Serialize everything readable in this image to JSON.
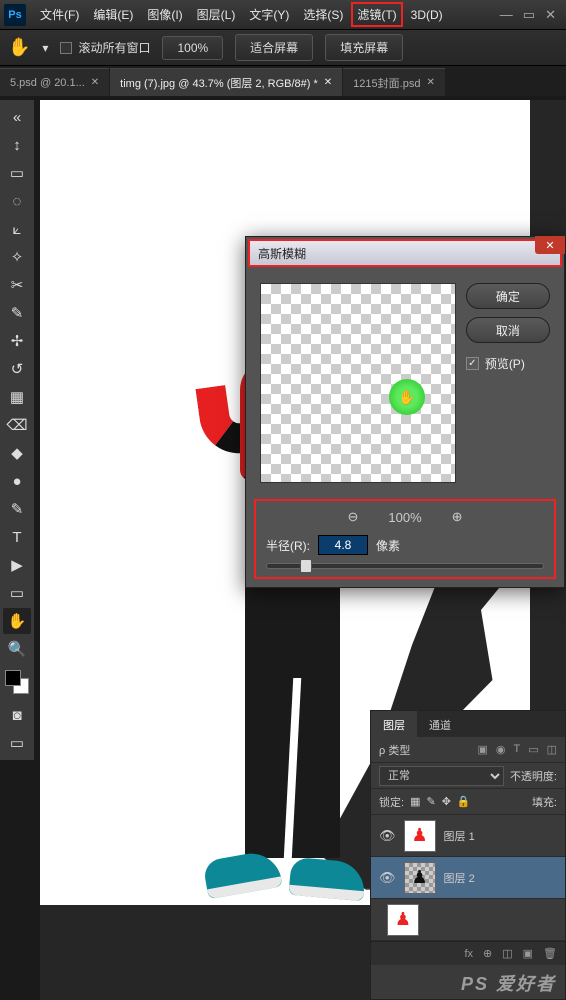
{
  "menu": {
    "items": [
      "文件(F)",
      "编辑(E)",
      "图像(I)",
      "图层(L)",
      "文字(Y)",
      "选择(S)",
      "滤镜(T)",
      "3D(D)"
    ],
    "highlight_index": 6
  },
  "window_controls": {
    "min": "—",
    "max": "▭",
    "close": "✕"
  },
  "options": {
    "scroll_all": "滚动所有窗口",
    "zoom": "100%",
    "fit": "适合屏幕",
    "fill": "填充屏幕"
  },
  "tabs": [
    {
      "label": "5.psd @ 20.1...",
      "active": false
    },
    {
      "label": "timg (7).jpg @ 43.7% (图层 2, RGB/8#) *",
      "active": true
    },
    {
      "label": "1215封面.psd",
      "active": false
    }
  ],
  "tools": [
    "↕",
    "▭",
    "◌",
    "⟀",
    "✧",
    "✂",
    "✎",
    "✢",
    "↺",
    "▦",
    "⌫",
    "◆",
    "●",
    "✎",
    "T",
    "▶",
    "▭",
    "✋",
    "🔍"
  ],
  "dialog": {
    "title": "高斯模糊",
    "ok": "确定",
    "cancel": "取消",
    "preview_label": "预览(P)",
    "preview_checked": "✓",
    "zoom_out": "⊖",
    "zoom_pct": "100%",
    "zoom_in": "⊕",
    "radius_label": "半径(R):",
    "radius_value": "4.8",
    "radius_unit": "像素",
    "hand_glyph": "✋"
  },
  "layers_panel": {
    "tab_layers": "图层",
    "tab_channels": "通道",
    "kind_label": "ρ 类型",
    "filter_icons": [
      "▣",
      "◉",
      "T",
      "▭",
      "◫"
    ],
    "blend": "正常",
    "opacity_label": "不透明度:",
    "lock_label": "锁定:",
    "fill_label": "填充:",
    "lock_icons": [
      "▦",
      "✎",
      "✥",
      "🔒"
    ],
    "layers": [
      {
        "eye": "👁",
        "name": "图层 1",
        "thumb": "red",
        "sel": false
      },
      {
        "eye": "👁",
        "name": "图层 2",
        "thumb": "trans",
        "sel": true
      },
      {
        "eye": "",
        "name": "",
        "thumb": "red",
        "sel": false
      }
    ],
    "foot_icons": [
      "fx",
      "⊕",
      "◫",
      "▣",
      "🗑"
    ]
  },
  "watermark": "PS 爱好者"
}
